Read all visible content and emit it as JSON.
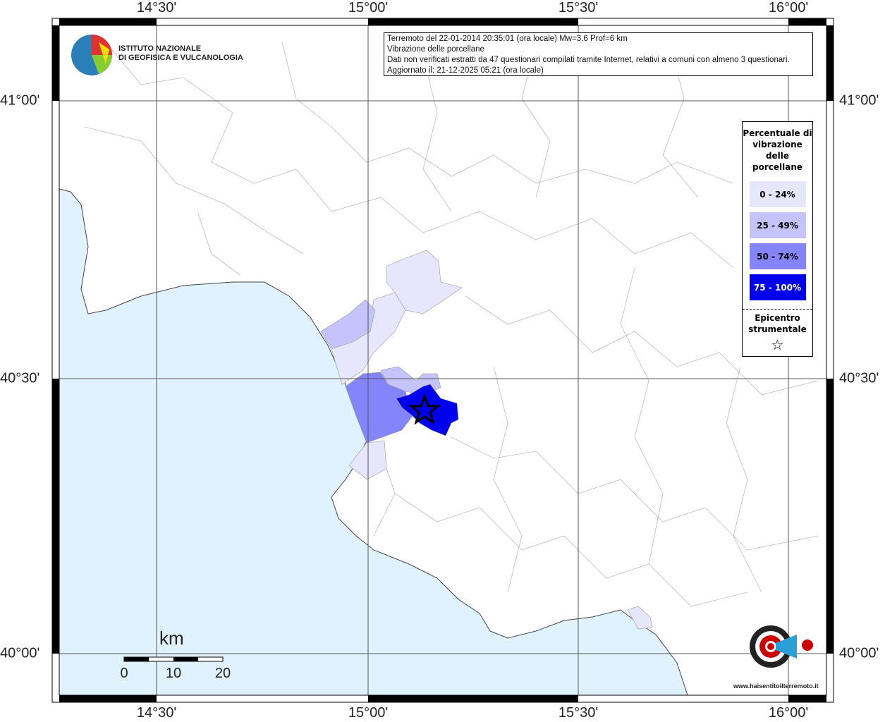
{
  "info": {
    "line1": "Terremoto del 22-01-2014 20:35:01 (ora locale) Mw=3.6 Prof=6 km",
    "line2": "Vibrazione delle porcellane",
    "line3": "Dati non verificati estratti da 47 questionari compilati tramite Internet, relativi a comuni con almeno 3 questionari.",
    "line4": "Aggiornato il: 21-12-2025 05:21 (ora locale)"
  },
  "legend": {
    "title": "Percentuale di vibrazione delle porcellane",
    "classes": [
      {
        "label": "0 - 24%",
        "color": "#e6e6fc"
      },
      {
        "label": "25 - 49%",
        "color": "#c4c4fa"
      },
      {
        "label": "50 - 74%",
        "color": "#8484fb"
      },
      {
        "label": "75 - 100%",
        "color": "#0000ee"
      }
    ],
    "epicenter_label": "Epicentro strumentale",
    "epicenter_icon": "star-icon"
  },
  "axes": {
    "lon": [
      "14°30'",
      "15°00'",
      "15°30'",
      "16°00'"
    ],
    "lat": [
      "41°00'",
      "40°30'",
      "40°00'"
    ]
  },
  "scale": {
    "unit": "km",
    "ticks": [
      "0",
      "10",
      "20"
    ]
  },
  "logos": {
    "ingv": "ISTITUTO NAZIONALE DI GEOFISICA E VULCANOLOGIA",
    "ingv_line1": "ISTITUTO NAZIONALE",
    "ingv_line2": "DI GEOFISICA E VULCANOLOGIA",
    "hst": "www.haisentitoilterremoto.it"
  },
  "colors": {
    "sea": "#e0f2fd",
    "land": "#ffffff",
    "border": "#aaaaaa"
  }
}
